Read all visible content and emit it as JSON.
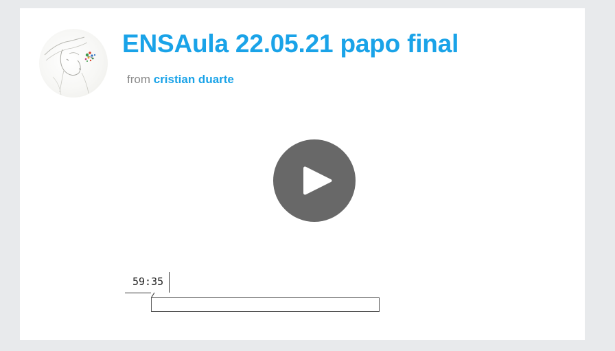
{
  "video": {
    "title": "ENSAula 22.05.21 papo final",
    "from_label": "from",
    "author": "cristian duarte",
    "duration": "59:35",
    "progress_fraction": 0
  },
  "icons": {
    "avatar": "author-avatar-drawing",
    "play": "play-icon"
  },
  "colors": {
    "accent": "#1aa3e8",
    "play_button": "#686868",
    "background": "#e8eaec",
    "card": "#ffffff"
  }
}
